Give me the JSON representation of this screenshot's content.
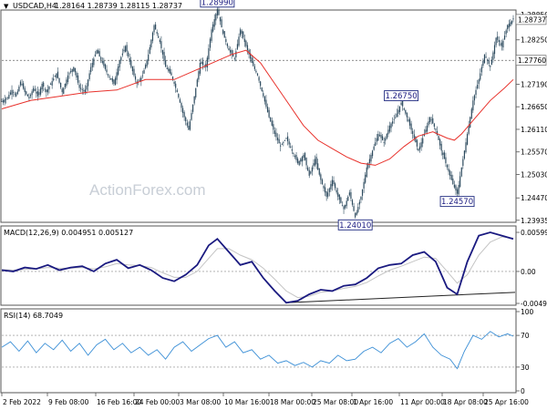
{
  "chart_data": [
    {
      "type": "candlestick",
      "instrument": "USDCAD",
      "timeframe": "H4",
      "ohlc_header": {
        "open": "1.28164",
        "high": "1.28739",
        "low": "1.28115",
        "close": "1.28737"
      },
      "current_price": "1.28737",
      "ref_line_price": "1.27760",
      "y_ticks": [
        "1.28850",
        "1.28250",
        "1.27190",
        "1.26650",
        "1.26110",
        "1.25570",
        "1.25030",
        "1.24470",
        "1.23935"
      ],
      "ylim": [
        1.2393,
        1.2892
      ],
      "x_tick_labels": [
        "2 Feb 2022",
        "9 Feb 08:00",
        "16 Feb 16:00",
        "24 Feb 00:00",
        "3 Mar 08:00",
        "10 Mar 16:00",
        "18 Mar 00:00",
        "25 Mar 08:00",
        "1 Apr 16:00",
        "11 Apr 00:00",
        "18 Apr 08:00",
        "25 Apr 16:00"
      ],
      "price_path": [
        [
          0,
          1.2678
        ],
        [
          4,
          1.2688
        ],
        [
          7,
          1.2705
        ],
        [
          10,
          1.269
        ],
        [
          13,
          1.2725
        ],
        [
          16,
          1.27
        ],
        [
          19,
          1.2685
        ],
        [
          22,
          1.271
        ],
        [
          25,
          1.269
        ],
        [
          28,
          1.272
        ],
        [
          31,
          1.27
        ],
        [
          34,
          1.272
        ],
        [
          38,
          1.2745
        ],
        [
          42,
          1.27
        ],
        [
          46,
          1.274
        ],
        [
          50,
          1.276
        ],
        [
          54,
          1.271
        ],
        [
          58,
          1.27
        ],
        [
          62,
          1.276
        ],
        [
          66,
          1.28
        ],
        [
          70,
          1.277
        ],
        [
          74,
          1.274
        ],
        [
          78,
          1.272
        ],
        [
          82,
          1.2775
        ],
        [
          86,
          1.281
        ],
        [
          90,
          1.276
        ],
        [
          94,
          1.272
        ],
        [
          98,
          1.274
        ],
        [
          102,
          1.279
        ],
        [
          106,
          1.286
        ],
        [
          110,
          1.282
        ],
        [
          114,
          1.276
        ],
        [
          118,
          1.274
        ],
        [
          122,
          1.27
        ],
        [
          126,
          1.265
        ],
        [
          130,
          1.261
        ],
        [
          134,
          1.269
        ],
        [
          138,
          1.277
        ],
        [
          142,
          1.276
        ],
        [
          146,
          1.285
        ],
        [
          150,
          1.2899
        ],
        [
          154,
          1.284
        ],
        [
          158,
          1.28
        ],
        [
          162,
          1.278
        ],
        [
          166,
          1.285
        ],
        [
          170,
          1.281
        ],
        [
          174,
          1.277
        ],
        [
          178,
          1.274
        ],
        [
          182,
          1.269
        ],
        [
          186,
          1.264
        ],
        [
          190,
          1.26
        ],
        [
          194,
          1.257
        ],
        [
          198,
          1.259
        ],
        [
          202,
          1.256
        ],
        [
          206,
          1.253
        ],
        [
          210,
          1.255
        ],
        [
          214,
          1.25
        ],
        [
          218,
          1.254
        ],
        [
          222,
          1.249
        ],
        [
          226,
          1.245
        ],
        [
          230,
          1.249
        ],
        [
          234,
          1.245
        ],
        [
          238,
          1.242
        ],
        [
          242,
          1.246
        ],
        [
          246,
          1.2401
        ],
        [
          250,
          1.245
        ],
        [
          254,
          1.252
        ],
        [
          258,
          1.256
        ],
        [
          262,
          1.26
        ],
        [
          266,
          1.258
        ],
        [
          270,
          1.262
        ],
        [
          274,
          1.264
        ],
        [
          278,
          1.2675
        ],
        [
          282,
          1.264
        ],
        [
          286,
          1.26
        ],
        [
          290,
          1.256
        ],
        [
          294,
          1.26
        ],
        [
          298,
          1.264
        ],
        [
          302,
          1.261
        ],
        [
          306,
          1.256
        ],
        [
          310,
          1.252
        ],
        [
          314,
          1.248
        ],
        [
          317,
          1.2457
        ],
        [
          320,
          1.252
        ],
        [
          324,
          1.26
        ],
        [
          328,
          1.268
        ],
        [
          332,
          1.273
        ],
        [
          336,
          1.279
        ],
        [
          340,
          1.276
        ],
        [
          344,
          1.283
        ],
        [
          348,
          1.281
        ],
        [
          352,
          1.286
        ],
        [
          356,
          1.2874
        ]
      ],
      "ma_path": [
        [
          0,
          1.266
        ],
        [
          20,
          1.268
        ],
        [
          40,
          1.269
        ],
        [
          60,
          1.27
        ],
        [
          80,
          1.2705
        ],
        [
          100,
          1.273
        ],
        [
          120,
          1.273
        ],
        [
          140,
          1.276
        ],
        [
          160,
          1.279
        ],
        [
          170,
          1.28
        ],
        [
          180,
          1.277
        ],
        [
          190,
          1.272
        ],
        [
          200,
          1.267
        ],
        [
          210,
          1.262
        ],
        [
          220,
          1.2585
        ],
        [
          230,
          1.2565
        ],
        [
          240,
          1.2545
        ],
        [
          250,
          1.253
        ],
        [
          260,
          1.2525
        ],
        [
          270,
          1.254
        ],
        [
          280,
          1.257
        ],
        [
          290,
          1.2595
        ],
        [
          300,
          1.2605
        ],
        [
          310,
          1.259
        ],
        [
          315,
          1.2585
        ],
        [
          320,
          1.26
        ],
        [
          330,
          1.264
        ],
        [
          340,
          1.268
        ],
        [
          350,
          1.271
        ],
        [
          356,
          1.273
        ]
      ],
      "annotations": [
        {
          "label": "1.28990",
          "x": 150,
          "y": 1.2899,
          "side": "above"
        },
        {
          "label": "1.26750",
          "x": 278,
          "y": 1.2675,
          "side": "above"
        },
        {
          "label": "1.24570",
          "x": 317,
          "y": 1.2457,
          "side": "below"
        },
        {
          "label": "1.24010",
          "x": 246,
          "y": 1.2401,
          "side": "below"
        }
      ],
      "colors": {
        "candles": "#2c4a5e",
        "ma": "#e8312b",
        "callout_box": "#1f2a80"
      }
    },
    {
      "type": "line",
      "indicator": "MACD",
      "label": "MACD(12,26,9) 0.004951 0.005127",
      "y_ticks": [
        "0.005996",
        "0.00",
        "-0.004901"
      ],
      "ylim": [
        -0.0049,
        0.006
      ],
      "series": [
        {
          "values": [
            [
              0,
              0.0002
            ],
            [
              8,
              0.0
            ],
            [
              16,
              0.0006
            ],
            [
              24,
              0.0004
            ],
            [
              32,
              0.001
            ],
            [
              40,
              0.0002
            ],
            [
              48,
              0.0006
            ],
            [
              56,
              0.0008
            ],
            [
              64,
              0.0
            ],
            [
              72,
              0.0012
            ],
            [
              80,
              0.0018
            ],
            [
              88,
              0.0005
            ],
            [
              96,
              0.001
            ],
            [
              104,
              0.0002
            ],
            [
              112,
              -0.001
            ],
            [
              120,
              -0.0015
            ],
            [
              128,
              -0.0005
            ],
            [
              136,
              0.001
            ],
            [
              144,
              0.004
            ],
            [
              150,
              0.005
            ],
            [
              158,
              0.003
            ],
            [
              166,
              0.001
            ],
            [
              174,
              0.0015
            ],
            [
              182,
              -0.001
            ],
            [
              190,
              -0.003
            ],
            [
              198,
              -0.0048
            ],
            [
              206,
              -0.0045
            ],
            [
              214,
              -0.0035
            ],
            [
              222,
              -0.0028
            ],
            [
              230,
              -0.003
            ],
            [
              238,
              -0.0022
            ],
            [
              246,
              -0.002
            ],
            [
              254,
              -0.001
            ],
            [
              262,
              0.0005
            ],
            [
              270,
              0.001
            ],
            [
              278,
              0.0012
            ],
            [
              286,
              0.0025
            ],
            [
              294,
              0.003
            ],
            [
              302,
              0.0015
            ],
            [
              310,
              -0.0025
            ],
            [
              317,
              -0.0035
            ],
            [
              324,
              0.0015
            ],
            [
              332,
              0.0055
            ],
            [
              340,
              0.006
            ],
            [
              348,
              0.0055
            ],
            [
              356,
              0.005
            ]
          ]
        },
        {
          "values": [
            [
              0,
              0.0003
            ],
            [
              8,
              0.0002
            ],
            [
              16,
              0.0003
            ],
            [
              24,
              0.0004
            ],
            [
              32,
              0.0006
            ],
            [
              40,
              0.0005
            ],
            [
              48,
              0.0005
            ],
            [
              56,
              0.0006
            ],
            [
              64,
              0.0004
            ],
            [
              72,
              0.0007
            ],
            [
              80,
              0.0012
            ],
            [
              88,
              0.001
            ],
            [
              96,
              0.0009
            ],
            [
              104,
              0.0006
            ],
            [
              112,
              -0.0002
            ],
            [
              120,
              -0.0009
            ],
            [
              128,
              -0.0009
            ],
            [
              136,
              0.0
            ],
            [
              144,
              0.002
            ],
            [
              150,
              0.0035
            ],
            [
              158,
              0.0035
            ],
            [
              166,
              0.0025
            ],
            [
              174,
              0.0018
            ],
            [
              182,
              0.0005
            ],
            [
              190,
              -0.0012
            ],
            [
              198,
              -0.003
            ],
            [
              206,
              -0.004
            ],
            [
              214,
              -0.0038
            ],
            [
              222,
              -0.0032
            ],
            [
              230,
              -0.003
            ],
            [
              238,
              -0.0026
            ],
            [
              246,
              -0.0023
            ],
            [
              254,
              -0.0017
            ],
            [
              262,
              -0.0007
            ],
            [
              270,
              0.0002
            ],
            [
              278,
              0.0008
            ],
            [
              286,
              0.0015
            ],
            [
              294,
              0.0022
            ],
            [
              302,
              0.002
            ],
            [
              310,
              0.0
            ],
            [
              317,
              -0.0018
            ],
            [
              324,
              -0.0005
            ],
            [
              332,
              0.0025
            ],
            [
              340,
              0.0045
            ],
            [
              348,
              0.0053
            ],
            [
              356,
              0.0051
            ]
          ]
        }
      ],
      "trendline": [
        [
          198,
          -0.0048
        ],
        [
          356,
          -0.0032
        ]
      ],
      "colors": {
        "macd": "#1a1a80",
        "signal": "#c4c4c4",
        "trendline": "#222222"
      }
    },
    {
      "type": "line",
      "indicator": "RSI",
      "label": "RSI(14) 68.7049",
      "y_ticks": [
        "100",
        "70",
        "30",
        "0"
      ],
      "ylim": [
        0,
        100
      ],
      "levels": [
        70,
        30
      ],
      "series": [
        {
          "values": [
            [
              0,
              55
            ],
            [
              6,
              62
            ],
            [
              12,
              50
            ],
            [
              18,
              63
            ],
            [
              24,
              48
            ],
            [
              30,
              60
            ],
            [
              36,
              52
            ],
            [
              42,
              64
            ],
            [
              48,
              50
            ],
            [
              54,
              60
            ],
            [
              60,
              45
            ],
            [
              66,
              58
            ],
            [
              72,
              65
            ],
            [
              78,
              52
            ],
            [
              84,
              60
            ],
            [
              90,
              48
            ],
            [
              96,
              55
            ],
            [
              102,
              45
            ],
            [
              108,
              52
            ],
            [
              114,
              40
            ],
            [
              120,
              55
            ],
            [
              126,
              62
            ],
            [
              132,
              50
            ],
            [
              138,
              58
            ],
            [
              144,
              66
            ],
            [
              150,
              70
            ],
            [
              156,
              55
            ],
            [
              162,
              62
            ],
            [
              168,
              48
            ],
            [
              174,
              52
            ],
            [
              180,
              40
            ],
            [
              186,
              45
            ],
            [
              192,
              35
            ],
            [
              198,
              38
            ],
            [
              204,
              32
            ],
            [
              210,
              36
            ],
            [
              216,
              30
            ],
            [
              222,
              38
            ],
            [
              228,
              35
            ],
            [
              234,
              45
            ],
            [
              240,
              38
            ],
            [
              246,
              40
            ],
            [
              252,
              50
            ],
            [
              258,
              55
            ],
            [
              264,
              48
            ],
            [
              270,
              60
            ],
            [
              276,
              66
            ],
            [
              282,
              55
            ],
            [
              288,
              62
            ],
            [
              294,
              72
            ],
            [
              300,
              55
            ],
            [
              306,
              45
            ],
            [
              312,
              40
            ],
            [
              317,
              28
            ],
            [
              322,
              50
            ],
            [
              328,
              70
            ],
            [
              334,
              65
            ],
            [
              340,
              75
            ],
            [
              346,
              68
            ],
            [
              352,
              72
            ],
            [
              356,
              69
            ]
          ]
        }
      ],
      "colors": {
        "rsi": "#3b8fd6"
      }
    }
  ],
  "watermark": "ActionForex.com"
}
